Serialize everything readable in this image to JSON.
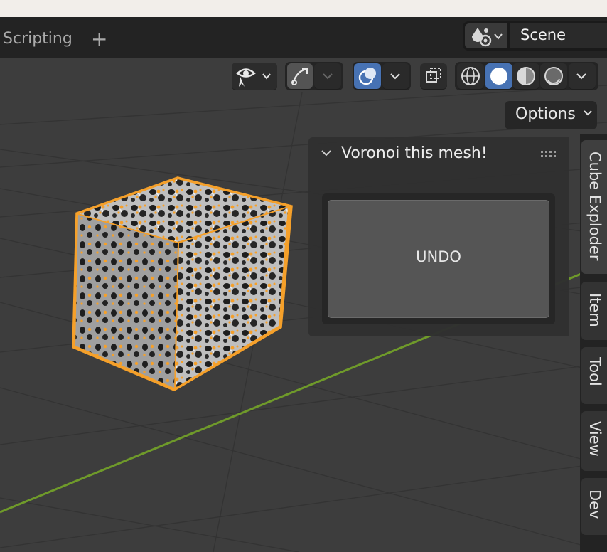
{
  "workspace": {
    "tab_label": "Scripting",
    "add_tab": "+"
  },
  "scene": {
    "name": "Scene",
    "icon": "scene-icon"
  },
  "header": {
    "buttons": [
      {
        "name": "visibility-icon"
      },
      {
        "name": "gizmo-icon"
      },
      {
        "name": "overlay-icon",
        "active": true
      },
      {
        "name": "xray-icon"
      },
      {
        "name": "wireframe-shading-icon"
      },
      {
        "name": "solid-shading-icon",
        "active": true
      },
      {
        "name": "material-preview-icon"
      },
      {
        "name": "rendered-shading-icon"
      }
    ],
    "chevron": "⌄",
    "options_label": "Options"
  },
  "panel": {
    "title": "Voronoi this mesh!",
    "collapse_icon": "⌄",
    "grip": "::::",
    "undo_label": "UNDO"
  },
  "sidebar_tabs": [
    {
      "label": "Cube Exploder",
      "active": true
    },
    {
      "label": "Item"
    },
    {
      "label": "Tool"
    },
    {
      "label": "View"
    },
    {
      "label": "Dev"
    }
  ],
  "colors": {
    "accent": "#4772b3",
    "selection": "#f5a02a",
    "x_axis": "#6f9a2a",
    "background": "#3d3d3d"
  }
}
